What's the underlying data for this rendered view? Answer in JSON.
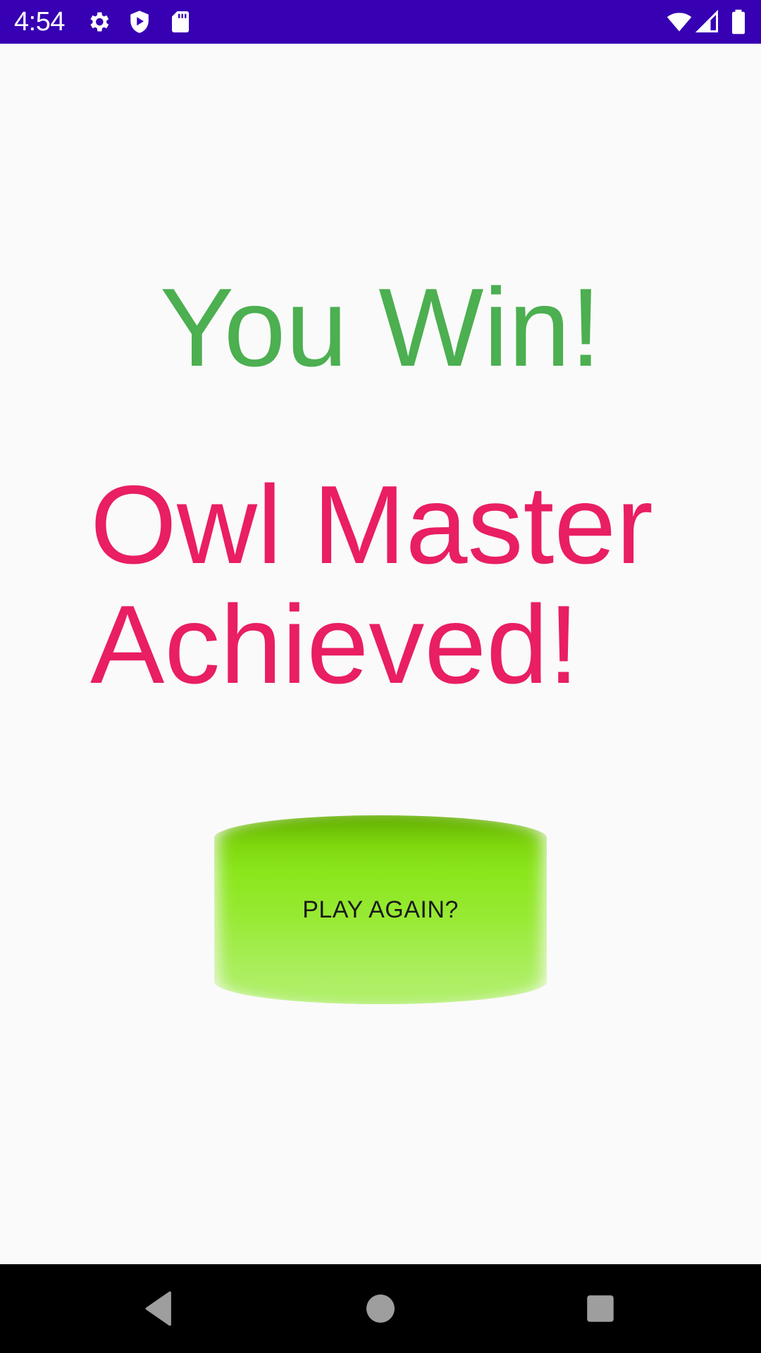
{
  "status_bar": {
    "time": "4:54",
    "background_color": "#3700b3",
    "left_icons": [
      "gear-icon",
      "shield-play-icon",
      "sd-card-icon"
    ],
    "right_icons": [
      "wifi-icon",
      "cell-signal-icon",
      "battery-icon"
    ]
  },
  "main": {
    "win_text": "You Win!",
    "win_color": "#4caf50",
    "achievement_text_line1": "Owl Master",
    "achievement_text_line2": "Achieved!",
    "achievement_color": "#e91e63",
    "play_again_label": "PLAY AGAIN?"
  },
  "nav_bar": {
    "buttons": [
      "back-icon",
      "home-icon",
      "recents-icon"
    ]
  }
}
